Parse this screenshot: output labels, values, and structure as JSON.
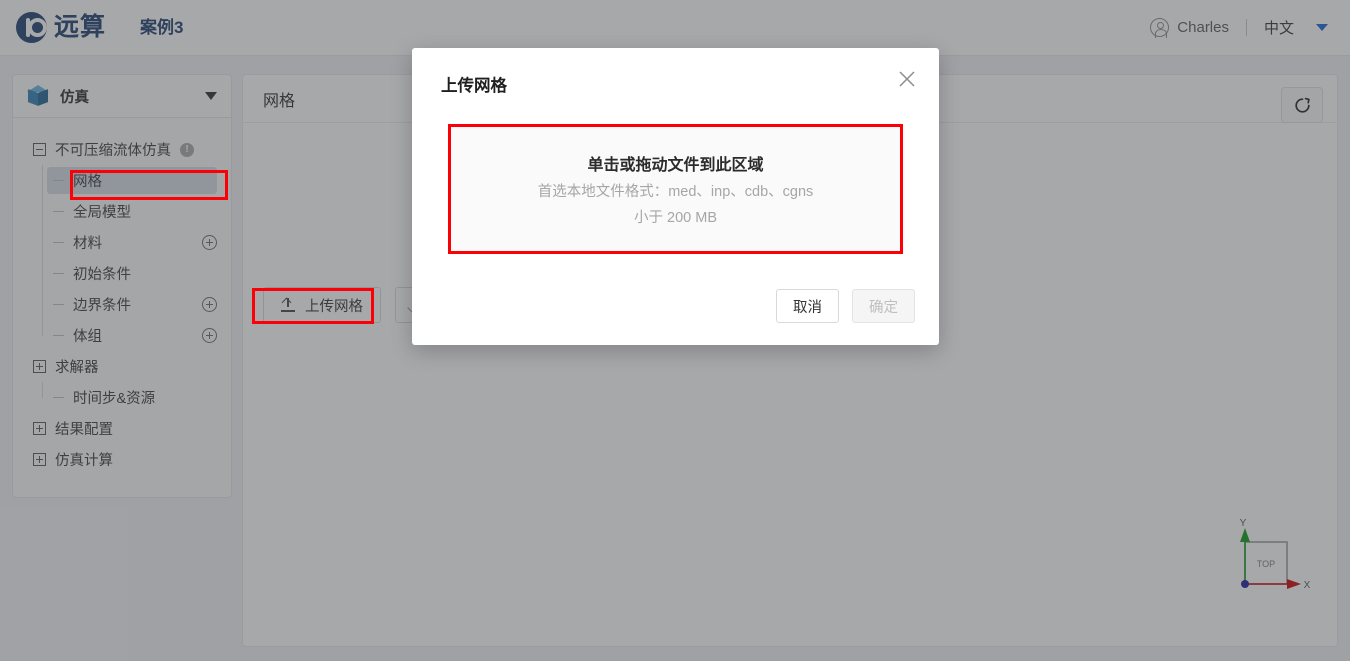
{
  "header": {
    "brand_name": "远算",
    "brand_logo_icon": "company-logo-icon",
    "project_title": "案例3",
    "user_name": "Charles",
    "user_icon": "user-avatar-icon",
    "language": "中文",
    "language_caret_icon": "chevron-down-icon",
    "brand_color": "#1c3d6e",
    "accent_color": "#1664d6"
  },
  "sidebar": {
    "panel_title": "仿真",
    "panel_icon": "cube-icon",
    "collapse_caret_icon": "chevron-down-icon",
    "tree": [
      {
        "label": "不可压缩流体仿真",
        "level": 0,
        "toggle": "minus",
        "badge": "info-warning-icon",
        "action": "",
        "selected": false
      },
      {
        "label": "网格",
        "level": 1,
        "toggle": "",
        "badge": "",
        "action": "",
        "selected": true
      },
      {
        "label": "全局模型",
        "level": 1,
        "toggle": "",
        "badge": "",
        "action": "",
        "selected": false
      },
      {
        "label": "材料",
        "level": 1,
        "toggle": "",
        "badge": "",
        "action": "plus-circle-icon",
        "selected": false
      },
      {
        "label": "初始条件",
        "level": 1,
        "toggle": "",
        "badge": "",
        "action": "",
        "selected": false
      },
      {
        "label": "边界条件",
        "level": 1,
        "toggle": "",
        "badge": "",
        "action": "plus-circle-icon",
        "selected": false
      },
      {
        "label": "体组",
        "level": 1,
        "toggle": "",
        "badge": "",
        "action": "plus-circle-icon",
        "selected": false
      },
      {
        "label": "求解器",
        "level": 0,
        "toggle": "plus",
        "badge": "",
        "action": "",
        "selected": false
      },
      {
        "label": "时间步&资源",
        "level": 1,
        "toggle": "",
        "badge": "",
        "action": "",
        "selected": false
      },
      {
        "label": "结果配置",
        "level": 0,
        "toggle": "plus",
        "badge": "",
        "action": "",
        "selected": false
      },
      {
        "label": "仿真计算",
        "level": 0,
        "toggle": "plus",
        "badge": "",
        "action": "",
        "selected": false
      }
    ]
  },
  "main": {
    "panel_title": "网格",
    "upload_button_label": "上传网格",
    "upload_button_icon": "upload-icon",
    "download_button_icon": "download-icon",
    "reset_view_icon": "refresh-icon",
    "axis_widget": {
      "x_label": "X",
      "y_label": "Y",
      "face_label": "TOP",
      "x_color": "#cc0000",
      "y_color": "#0a9a18",
      "origin_color": "#1b1b9e"
    }
  },
  "dialog": {
    "title": "上传网格",
    "close_icon": "close-icon",
    "dropzone_main": "单击或拖动文件到此区域",
    "dropzone_formats": "首选本地文件格式：med、inp、cdb、cgns",
    "dropzone_size": "小于 200 MB",
    "cancel_label": "取消",
    "confirm_label": "确定",
    "confirm_disabled": true
  },
  "annotations": {
    "color": "#fb0007",
    "boxes": [
      {
        "name": "mesh-tree-node-highlight"
      },
      {
        "name": "upload-mesh-button-highlight"
      },
      {
        "name": "dropzone-highlight"
      }
    ]
  }
}
